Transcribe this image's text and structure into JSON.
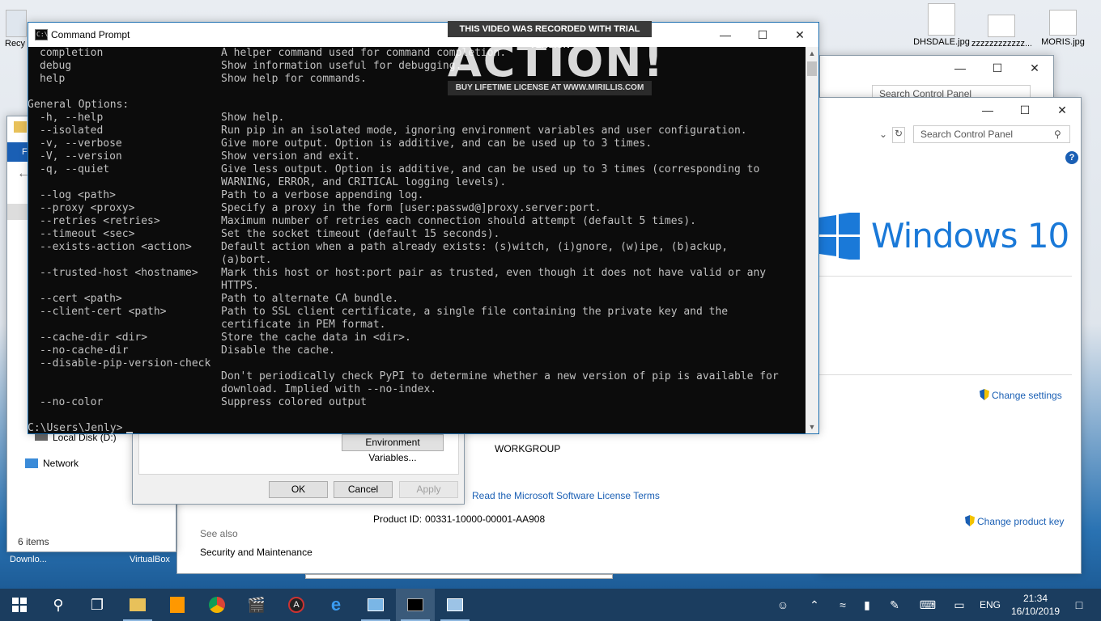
{
  "desktop": {
    "icons": [
      {
        "label": "Recy",
        "name": "recycle-bin"
      },
      {
        "label": "DHSDALE.jpg",
        "name": "file-dhsdale"
      },
      {
        "label": "zzzzzzzzzzzz...",
        "name": "file-zzz"
      },
      {
        "label": "MORIS.jpg",
        "name": "file-moris"
      },
      {
        "label": "Downlo...",
        "name": "downloads"
      },
      {
        "label": "VirtualBox",
        "name": "virtualbox"
      }
    ]
  },
  "cmd": {
    "title": "Command Prompt",
    "lines": [
      {
        "c1": "completion",
        "c2": "A helper command used for command completion."
      },
      {
        "c1": "debug",
        "c2": "Show information useful for debugging."
      },
      {
        "c1": "help",
        "c2": "Show help for commands."
      },
      {
        "c0": ""
      },
      {
        "c0": "General Options:"
      },
      {
        "c1": "-h, --help",
        "c2": "Show help."
      },
      {
        "c1": "--isolated",
        "c2": "Run pip in an isolated mode, ignoring environment variables and user configuration."
      },
      {
        "c1": "-v, --verbose",
        "c2": "Give more output. Option is additive, and can be used up to 3 times."
      },
      {
        "c1": "-V, --version",
        "c2": "Show version and exit."
      },
      {
        "c1": "-q, --quiet",
        "c2": "Give less output. Option is additive, and can be used up to 3 times (corresponding to"
      },
      {
        "c1": "",
        "c2": "WARNING, ERROR, and CRITICAL logging levels)."
      },
      {
        "c1": "--log <path>",
        "c2": "Path to a verbose appending log."
      },
      {
        "c1": "--proxy <proxy>",
        "c2": "Specify a proxy in the form [user:passwd@]proxy.server:port."
      },
      {
        "c1": "--retries <retries>",
        "c2": "Maximum number of retries each connection should attempt (default 5 times)."
      },
      {
        "c1": "--timeout <sec>",
        "c2": "Set the socket timeout (default 15 seconds)."
      },
      {
        "c1": "--exists-action <action>",
        "c2": "Default action when a path already exists: (s)witch, (i)gnore, (w)ipe, (b)ackup,"
      },
      {
        "c1": "",
        "c2": "(a)bort."
      },
      {
        "c1": "--trusted-host <hostname>",
        "c2": "Mark this host or host:port pair as trusted, even though it does not have valid or any"
      },
      {
        "c1": "",
        "c2": "HTTPS."
      },
      {
        "c1": "--cert <path>",
        "c2": "Path to alternate CA bundle."
      },
      {
        "c1": "--client-cert <path>",
        "c2": "Path to SSL client certificate, a single file containing the private key and the"
      },
      {
        "c1": "",
        "c2": "certificate in PEM format."
      },
      {
        "c1": "--cache-dir <dir>",
        "c2": "Store the cache data in <dir>."
      },
      {
        "c1": "--no-cache-dir",
        "c2": "Disable the cache."
      },
      {
        "c1": "--disable-pip-version-check",
        "c2": ""
      },
      {
        "c1": "",
        "c2": "Don't periodically check PyPI to determine whether a new version of pip is available for"
      },
      {
        "c1": "",
        "c2": "download. Implied with --no-index."
      },
      {
        "c1": "--no-color",
        "c2": "Suppress colored output"
      },
      {
        "c0": ""
      },
      {
        "c0": "C:\\Users\\Jenly>"
      }
    ]
  },
  "watermark": {
    "top": "THIS VIDEO WAS RECORDED WITH TRIAL VERSION",
    "logo": "ACTION!",
    "bottom": "BUY LIFETIME LICENSE AT WWW.MIRILLIS.COM"
  },
  "control_panel": {
    "search_placeholder": "Search Control Panel"
  },
  "system": {
    "search_placeholder": "Search Control Panel",
    "help": "?",
    "windows_logo_text": "Windows 10",
    "change_settings": "Change settings",
    "workgroup": "WORKGROUP",
    "license_link": "Read the Microsoft Software License Terms",
    "product_id_label": "Product ID:",
    "product_id": "00331-10000-00001-AA908",
    "change_product_key": "Change product key",
    "see_also": "See also",
    "security_maintenance": "Security and Maintenance"
  },
  "explorer": {
    "local_disk": "Local Disk (D:)",
    "network": "Network",
    "items_count": "6 items",
    "f_label": "Fi"
  },
  "dialog": {
    "env_button": "Environment Variables...",
    "ok": "OK",
    "cancel": "Cancel",
    "apply": "Apply"
  },
  "taskbar": {
    "language": "ENG",
    "time": "21:34",
    "date": "16/10/2019"
  }
}
